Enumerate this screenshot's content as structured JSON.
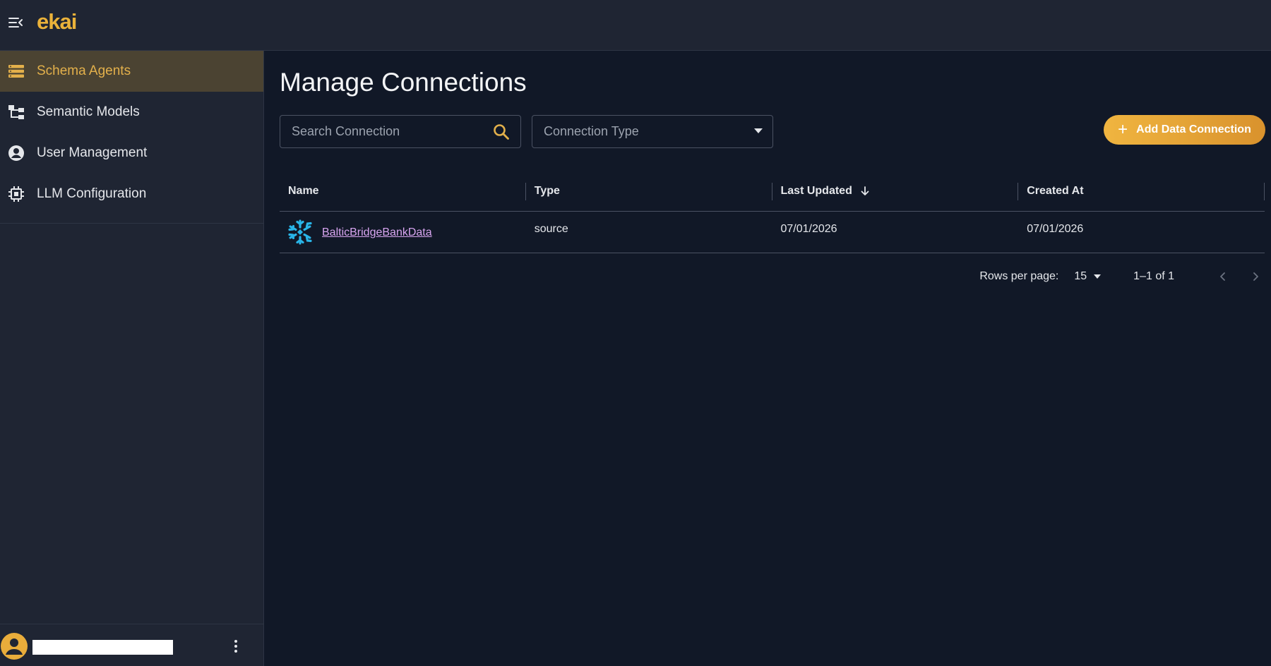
{
  "app": {
    "logo_text": "ekai"
  },
  "sidebar": {
    "items": [
      {
        "label": "Schema Agents",
        "icon": "database-list-icon",
        "active": true
      },
      {
        "label": "Semantic Models",
        "icon": "hierarchy-icon",
        "active": false
      },
      {
        "label": "User Management",
        "icon": "account-circle-icon",
        "active": false
      },
      {
        "label": "LLM Configuration",
        "icon": "chip-icon",
        "active": false
      }
    ]
  },
  "main": {
    "title": "Manage Connections",
    "search": {
      "placeholder": "Search Connection",
      "value": ""
    },
    "type_filter": {
      "placeholder": "Connection Type"
    },
    "add_button": {
      "label": "Add Data Connection"
    }
  },
  "table": {
    "columns": [
      "Name",
      "Type",
      "Last Updated",
      "Created At"
    ],
    "rows": [
      {
        "name": "BalticBridgeBankData",
        "type": "source",
        "last_updated": "07/01/2026",
        "created_at": "07/01/2026",
        "icon": "snowflake-icon"
      }
    ]
  },
  "pagination": {
    "rows_per_page_label": "Rows per page:",
    "rows_per_page_value": "15",
    "range_text": "1–1 of 1"
  },
  "colors": {
    "accent": "#e3b04b",
    "active_bg": "#4b4332",
    "link": "#d8a5f0",
    "snowflake": "#29b5e8"
  }
}
